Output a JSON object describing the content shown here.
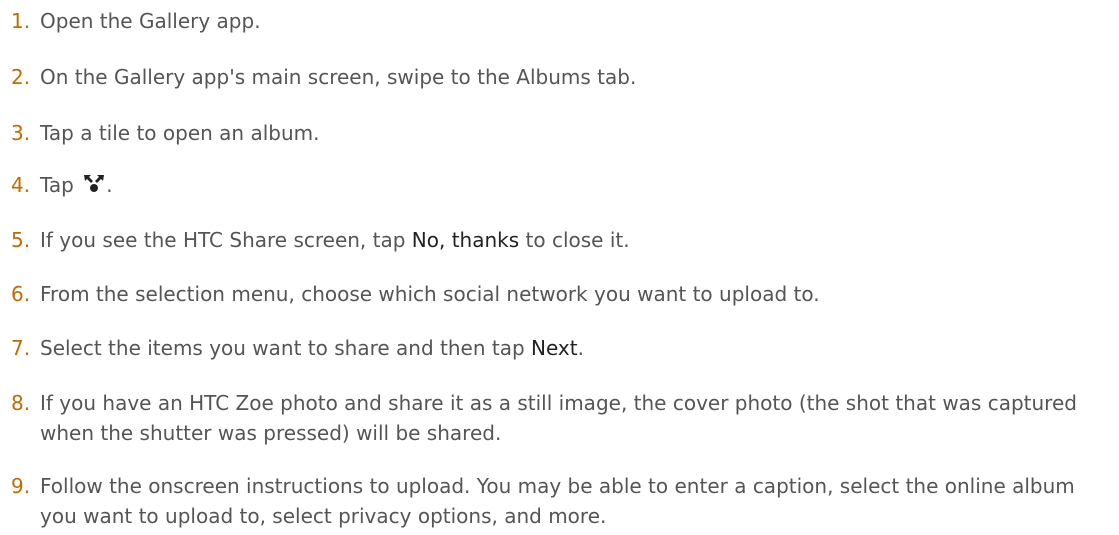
{
  "steps": [
    {
      "num": "1.",
      "text": "Open the Gallery app."
    },
    {
      "num": "2.",
      "text": "On the Gallery app's main screen, swipe to the Albums tab."
    },
    {
      "num": "3.",
      "text": "Tap a tile to open an album."
    },
    {
      "num": "4.",
      "before": "Tap ",
      "icon": "share-icon",
      "after": "."
    },
    {
      "num": "5.",
      "before": "If you see the HTC Share screen, tap ",
      "em": "No, thanks",
      "after": " to close it."
    },
    {
      "num": "6.",
      "text": "From the selection menu, choose which social network you want to upload to."
    },
    {
      "num": "7.",
      "before": "Select the items you want to share and then tap ",
      "em": "Next",
      "after": "."
    },
    {
      "num": "8.",
      "text": "If you have an HTC Zoe photo and share it as a still image, the cover photo (the shot that was captured when the shutter was pressed) will be shared."
    },
    {
      "num": "9.",
      "text": "Follow the onscreen instructions to upload. You may be able to enter a caption, select the online album you want to upload to, select privacy options, and more."
    }
  ],
  "colors": {
    "number": "#c46a00",
    "text": "#555555",
    "emphasis": "#222222"
  }
}
